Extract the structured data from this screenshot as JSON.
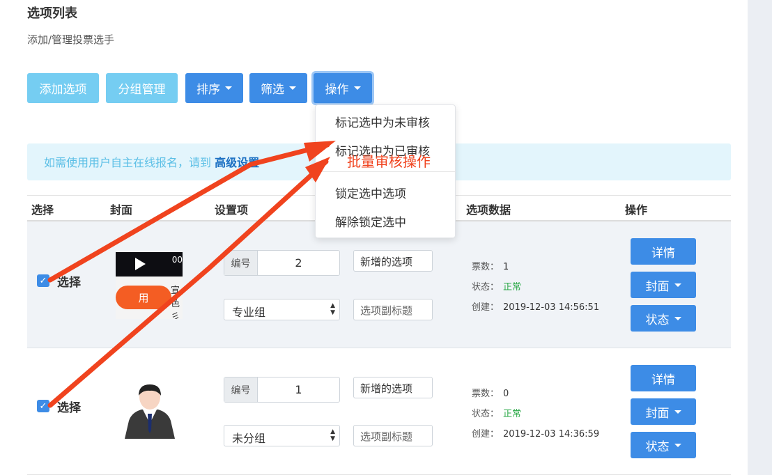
{
  "header": {
    "title": "选项列表",
    "subtitle": "添加/管理投票选手"
  },
  "toolbar": {
    "add_option": "添加选项",
    "group_manage": "分组管理",
    "sort": "排序",
    "filter": "筛选",
    "actions": "操作"
  },
  "actions_menu": {
    "items": [
      "标记选中为未审核",
      "标记选中为已审核",
      "锁定选中选项",
      "解除锁定选中"
    ]
  },
  "alert": {
    "text": "如需使用用户自主在线报名，请到",
    "link": "高级设置"
  },
  "annotation": "批量审核操作",
  "table": {
    "headers": {
      "select": "选择",
      "cover": "封面",
      "settings": "设置项",
      "data": "选项数据",
      "actions": "操作"
    }
  },
  "rows": [
    {
      "checked": true,
      "select_label": "选择",
      "thumb": {
        "corner": "00",
        "pill": "用",
        "side": "宣\n色彡"
      },
      "number_label": "编号",
      "number": "2",
      "group": "专业组",
      "name": "新增的选项",
      "subtitle_placeholder": "选项副标题",
      "votes_label": "票数：",
      "votes": "1",
      "status_label": "状态：",
      "status": "正常",
      "created_label": "创建：",
      "created": "2019-12-03 14:56:51",
      "btn_detail": "详情",
      "btn_cover": "封面",
      "btn_status": "状态"
    },
    {
      "checked": true,
      "select_label": "选择",
      "number_label": "编号",
      "number": "1",
      "group": "未分组",
      "name": "新增的选项",
      "subtitle_placeholder": "选项副标题",
      "votes_label": "票数：",
      "votes": "0",
      "status_label": "状态：",
      "status": "正常",
      "created_label": "创建：",
      "created": "2019-12-03 14:36:59",
      "btn_detail": "详情",
      "btn_cover": "封面",
      "btn_status": "状态"
    }
  ],
  "colors": {
    "primary": "#3d8ce6",
    "light": "#75cdf2",
    "arrow": "#f0431e",
    "status_ok": "#28a745"
  }
}
